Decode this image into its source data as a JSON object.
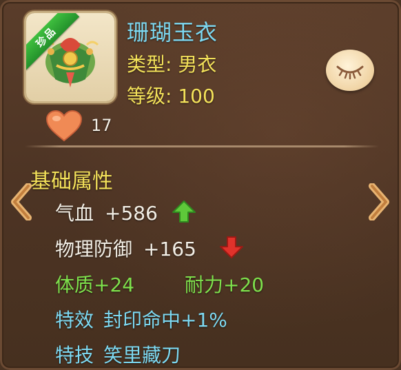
{
  "item": {
    "name": "珊瑚玉衣",
    "rarity_badge": "珍品",
    "type_label": "类型:",
    "type_value": "男衣",
    "level_label": "等级:",
    "level_value": "100",
    "like_count": "17"
  },
  "section_title": "基础属性",
  "stats": {
    "hp_label": "气血",
    "hp_value": "+586",
    "hp_trend": "up",
    "def_label": "物理防御",
    "def_value": "+165",
    "def_trend": "down",
    "con_text": "体质+24",
    "end_text": "耐力+20",
    "effect_label": "特效",
    "effect_value": "封印命中+1%",
    "skill_label": "特技",
    "skill_value": "笑里藏刀"
  },
  "icons": {
    "eye": "closed-eye-icon",
    "heart": "heart-icon",
    "up": "green-up-arrow-icon",
    "down": "red-down-arrow-icon",
    "prev": "chevron-left-icon",
    "next": "chevron-right-icon"
  },
  "colors": {
    "name": "#7dd9f2",
    "yellow": "#f4e25a",
    "green": "#7ee04c",
    "red": "#e0322b",
    "badge": "#2fa83a"
  }
}
